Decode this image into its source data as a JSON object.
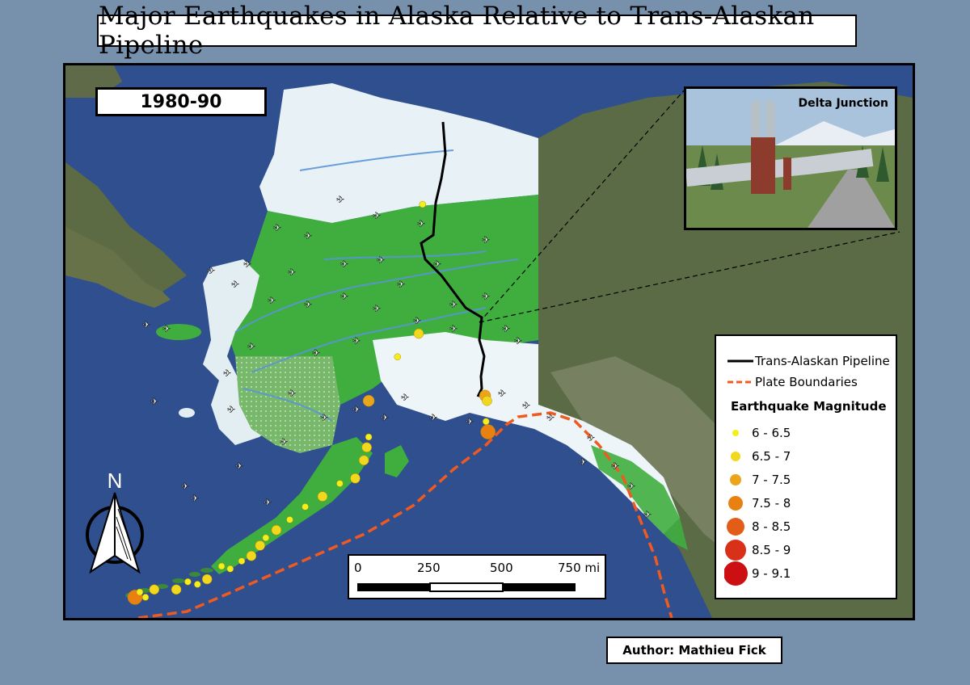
{
  "title": "Major Earthquakes in Alaska Relative to Trans-Alaskan Pipeline",
  "period_label": "1980-90",
  "inset_photo_label": "Delta Junction",
  "north_arrow_label": "N",
  "author": "Author: Mathieu Fick",
  "legend": {
    "pipeline_label": "Trans-Alaskan Pipeline",
    "plate_label": "Plate Boundaries",
    "magnitude_heading": "Earthquake Magnitude",
    "classes": [
      {
        "label": "6 - 6.5",
        "color": "#f3ee1e"
      },
      {
        "label": "6.5 - 7",
        "color": "#f1d81c"
      },
      {
        "label": "7 - 7.5",
        "color": "#eba51a"
      },
      {
        "label": "7.5 - 8",
        "color": "#e88012"
      },
      {
        "label": "8 - 8.5",
        "color": "#e35d18"
      },
      {
        "label": "8.5 - 9",
        "color": "#d9301a"
      },
      {
        "label": "9 - 9.1",
        "color": "#cc0f12"
      }
    ]
  },
  "scale_bar": {
    "ticks": [
      "0",
      "250",
      "500",
      "750 mi"
    ]
  },
  "colors": {
    "ocean": "#2f4f8e",
    "forest": "#3fae3f",
    "tundra": "#e8f1f6",
    "pipeline": "#000000",
    "plate_boundary": "#ef5a20",
    "background": "#7791ad"
  },
  "earthquakes": [
    {
      "class": 0,
      "lon": -149.6,
      "lat": 66.2
    },
    {
      "class": 1,
      "lon": -150.0,
      "lat": 61.2
    },
    {
      "class": 0,
      "lon": -152.2,
      "lat": 60.3
    },
    {
      "class": 2,
      "lon": -155.2,
      "lat": 58.6
    },
    {
      "class": 2,
      "lon": -143.1,
      "lat": 58.8
    },
    {
      "class": 1,
      "lon": -142.9,
      "lat": 58.6
    },
    {
      "class": 3,
      "lon": -142.8,
      "lat": 57.4
    },
    {
      "class": 0,
      "lon": -143.0,
      "lat": 57.8
    },
    {
      "class": 0,
      "lon": -155.2,
      "lat": 57.2
    },
    {
      "class": 1,
      "lon": -155.4,
      "lat": 56.8
    },
    {
      "class": 1,
      "lon": -155.7,
      "lat": 56.3
    },
    {
      "class": 1,
      "lon": -156.6,
      "lat": 55.6
    },
    {
      "class": 0,
      "lon": -158.2,
      "lat": 55.4
    },
    {
      "class": 1,
      "lon": -160.0,
      "lat": 54.9
    },
    {
      "class": 0,
      "lon": -161.8,
      "lat": 54.5
    },
    {
      "class": 0,
      "lon": -163.4,
      "lat": 54.0
    },
    {
      "class": 1,
      "lon": -164.8,
      "lat": 53.6
    },
    {
      "class": 0,
      "lon": -165.9,
      "lat": 53.3
    },
    {
      "class": 1,
      "lon": -166.5,
      "lat": 53.0
    },
    {
      "class": 1,
      "lon": -167.4,
      "lat": 52.6
    },
    {
      "class": 0,
      "lon": -168.4,
      "lat": 52.4
    },
    {
      "class": 0,
      "lon": -169.6,
      "lat": 52.1
    },
    {
      "class": 0,
      "lon": -170.5,
      "lat": 52.2
    },
    {
      "class": 1,
      "lon": -172.0,
      "lat": 51.7
    },
    {
      "class": 0,
      "lon": -173.0,
      "lat": 51.5
    },
    {
      "class": 0,
      "lon": -174.0,
      "lat": 51.6
    },
    {
      "class": 1,
      "lon": -175.2,
      "lat": 51.3
    },
    {
      "class": 1,
      "lon": -177.5,
      "lat": 51.3
    },
    {
      "class": 0,
      "lon": -178.4,
      "lat": 51.0
    },
    {
      "class": 3,
      "lon": -179.5,
      "lat": 51.0
    },
    {
      "class": 0,
      "lon": -179.0,
      "lat": 51.2
    }
  ],
  "airports": 52
}
